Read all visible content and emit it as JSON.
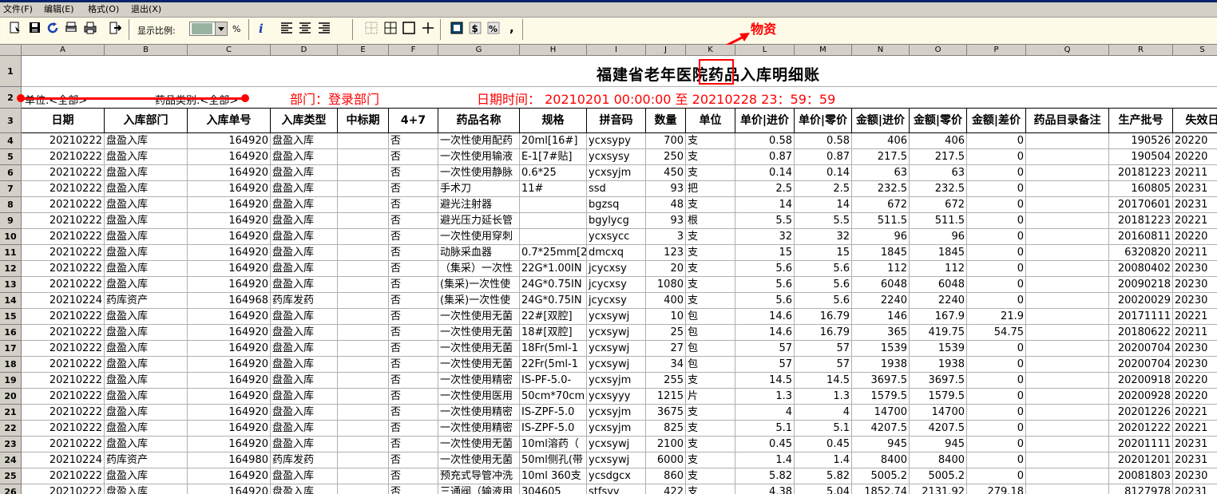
{
  "menu": [
    "文件(F)",
    "编辑(E)",
    "格式(O)",
    "退出(X)"
  ],
  "toolbar": {
    "zoom_label": "显示比例:",
    "zoom_unit": "%",
    "buttons": [
      "new-icon",
      "save-icon",
      "refresh-icon",
      "export-icon",
      "print-icon",
      "exit-icon",
      "info-icon",
      "align-left-icon",
      "align-center-icon",
      "align-right-icon",
      "grid-dotted-icon",
      "grid-all-icon",
      "grid-outer-icon",
      "grid-inner-icon",
      "number-format-icon",
      "currency-icon",
      "percent-icon",
      "comma-icon"
    ]
  },
  "annotations": {
    "wuzi": "物资",
    "bumen": "部门：登录部门",
    "riqi": "日期时间：  20210201  00:00:00  至  20210228  23：59：59",
    "color": "#ff0000"
  },
  "report": {
    "title": "福建省老年医院药品入库明细账",
    "unit_filter": "单位:<全部>",
    "drug_filter": "药品类别:<全部>"
  },
  "column_letters": [
    "A",
    "B",
    "C",
    "D",
    "E",
    "F",
    "G",
    "H",
    "I",
    "J",
    "K",
    "L",
    "M",
    "N",
    "O",
    "P",
    "Q",
    "R",
    "S"
  ],
  "headers": [
    "日期",
    "入库部门",
    "入库单号",
    "入库类型",
    "中标期",
    "4+7",
    "药品名称",
    "规格",
    "拼音码",
    "数量",
    "单位",
    "单价|进价",
    "单价|零价",
    "金额|进价",
    "金额|零价",
    "金额|差价",
    "药品目录备注",
    "生产批号",
    "失效日"
  ],
  "row_numbers": [
    "1",
    "2",
    "3",
    "4",
    "5",
    "6",
    "7",
    "8",
    "9",
    "10",
    "11",
    "12",
    "13",
    "14",
    "15",
    "16",
    "17",
    "18",
    "19",
    "20",
    "21",
    "22",
    "23",
    "24",
    "25",
    "26"
  ],
  "rows": [
    [
      "20210222",
      "盘盈入库",
      "164920",
      "盘盈入库",
      "",
      "否",
      "一次性使用配药",
      "20ml[16#]",
      "ycxsypy",
      "700",
      "支",
      "0.58",
      "0.58",
      "406",
      "406",
      "0",
      "",
      "190526",
      "20220"
    ],
    [
      "20210222",
      "盘盈入库",
      "164920",
      "盘盈入库",
      "",
      "否",
      "一次性使用输液",
      "E-1[7#贴]",
      "ycxsysy",
      "250",
      "支",
      "0.87",
      "0.87",
      "217.5",
      "217.5",
      "0",
      "",
      "190504",
      "20220"
    ],
    [
      "20210222",
      "盘盈入库",
      "164920",
      "盘盈入库",
      "",
      "否",
      "一次性使用静脉",
      "0.6*25",
      "ycxsyjm",
      "450",
      "支",
      "0.14",
      "0.14",
      "63",
      "63",
      "0",
      "",
      "20181223",
      "20211"
    ],
    [
      "20210222",
      "盘盈入库",
      "164920",
      "盘盈入库",
      "",
      "否",
      "手术刀",
      "11#",
      "ssd",
      "93",
      "把",
      "2.5",
      "2.5",
      "232.5",
      "232.5",
      "0",
      "",
      "160805",
      "20231"
    ],
    [
      "20210222",
      "盘盈入库",
      "164920",
      "盘盈入库",
      "",
      "否",
      "避光注射器",
      "",
      "bgzsq",
      "48",
      "支",
      "14",
      "14",
      "672",
      "672",
      "0",
      "",
      "20170601",
      "20231"
    ],
    [
      "20210222",
      "盘盈入库",
      "164920",
      "盘盈入库",
      "",
      "否",
      "避光压力延长管",
      "",
      "bgylycg",
      "93",
      "根",
      "5.5",
      "5.5",
      "511.5",
      "511.5",
      "0",
      "",
      "20181223",
      "20221"
    ],
    [
      "20210222",
      "盘盈入库",
      "164920",
      "盘盈入库",
      "",
      "否",
      "一次性使用穿刺",
      "",
      "ycxsycc",
      "3",
      "支",
      "32",
      "32",
      "96",
      "96",
      "0",
      "",
      "20160811",
      "20220"
    ],
    [
      "20210222",
      "盘盈入库",
      "164920",
      "盘盈入库",
      "",
      "否",
      "动脉采血器",
      "0.7*25mm[2",
      "dmcxq",
      "123",
      "支",
      "15",
      "15",
      "1845",
      "1845",
      "0",
      "",
      "6320820",
      "20211"
    ],
    [
      "20210222",
      "盘盈入库",
      "164920",
      "盘盈入库",
      "",
      "否",
      "（集采）一次性",
      "22G*1.00IN",
      "jcycxsy",
      "20",
      "支",
      "5.6",
      "5.6",
      "112",
      "112",
      "0",
      "",
      "20080402",
      "20230"
    ],
    [
      "20210222",
      "盘盈入库",
      "164920",
      "盘盈入库",
      "",
      "否",
      "(集采)一次性使",
      "24G*0.75IN",
      "jcycxsy",
      "1080",
      "支",
      "5.6",
      "5.6",
      "6048",
      "6048",
      "0",
      "",
      "20090218",
      "20230"
    ],
    [
      "20210224",
      "药库资产",
      "164968",
      "药库发药",
      "",
      "否",
      "(集采)一次性使",
      "24G*0.75IN",
      "jcycxsy",
      "400",
      "支",
      "5.6",
      "5.6",
      "2240",
      "2240",
      "0",
      "",
      "20020029",
      "20230"
    ],
    [
      "20210222",
      "盘盈入库",
      "164920",
      "盘盈入库",
      "",
      "否",
      "一次性使用无菌",
      "22#[双腔]",
      "ycxsywj",
      "10",
      "包",
      "14.6",
      "16.79",
      "146",
      "167.9",
      "21.9",
      "",
      "20171111",
      "20221"
    ],
    [
      "20210222",
      "盘盈入库",
      "164920",
      "盘盈入库",
      "",
      "否",
      "一次性使用无菌",
      "18#[双腔]",
      "ycxsywj",
      "25",
      "包",
      "14.6",
      "16.79",
      "365",
      "419.75",
      "54.75",
      "",
      "20180622",
      "20211"
    ],
    [
      "20210222",
      "盘盈入库",
      "164920",
      "盘盈入库",
      "",
      "否",
      "一次性使用无菌",
      "18Fr(5ml-1",
      "ycxsywj",
      "27",
      "包",
      "57",
      "57",
      "1539",
      "1539",
      "0",
      "",
      "20200704",
      "20230"
    ],
    [
      "20210222",
      "盘盈入库",
      "164920",
      "盘盈入库",
      "",
      "否",
      "一次性使用无菌",
      "22Fr(5ml-1",
      "ycxsywj",
      "34",
      "包",
      "57",
      "57",
      "1938",
      "1938",
      "0",
      "",
      "20200704",
      "20230"
    ],
    [
      "20210222",
      "盘盈入库",
      "164920",
      "盘盈入库",
      "",
      "否",
      "一次性使用精密",
      "IS-PF-5.0-",
      "ycxsyjm",
      "255",
      "支",
      "14.5",
      "14.5",
      "3697.5",
      "3697.5",
      "0",
      "",
      "20200918",
      "20220"
    ],
    [
      "20210222",
      "盘盈入库",
      "164920",
      "盘盈入库",
      "",
      "否",
      "一次性使用医用",
      "50cm*70cm",
      "ycxsyyy",
      "1215",
      "片",
      "1.3",
      "1.3",
      "1579.5",
      "1579.5",
      "0",
      "",
      "20200928",
      "20220"
    ],
    [
      "20210222",
      "盘盈入库",
      "164920",
      "盘盈入库",
      "",
      "否",
      "一次性使用精密",
      "IS-ZPF-5.0",
      "ycxsyjm",
      "3675",
      "支",
      "4",
      "4",
      "14700",
      "14700",
      "0",
      "",
      "20201226",
      "20221"
    ],
    [
      "20210222",
      "盘盈入库",
      "164920",
      "盘盈入库",
      "",
      "否",
      "一次性使用精密",
      "IS-ZPF-5.0",
      "ycxsyjm",
      "825",
      "支",
      "5.1",
      "5.1",
      "4207.5",
      "4207.5",
      "0",
      "",
      "20201222",
      "20221"
    ],
    [
      "20210222",
      "盘盈入库",
      "164920",
      "盘盈入库",
      "",
      "否",
      "一次性使用无菌",
      "10ml溶药（",
      "ycxsywj",
      "2100",
      "支",
      "0.45",
      "0.45",
      "945",
      "945",
      "0",
      "",
      "20201111",
      "20231"
    ],
    [
      "20210224",
      "药库资产",
      "164980",
      "药库发药",
      "",
      "否",
      "一次性使用无菌",
      "50ml侧孔(带",
      "ycxsywj",
      "6000",
      "支",
      "1.4",
      "1.4",
      "8400",
      "8400",
      "0",
      "",
      "20201201",
      "20231"
    ],
    [
      "20210222",
      "盘盈入库",
      "164920",
      "盘盈入库",
      "",
      "否",
      "预充式导管冲洗",
      "10ml   360支",
      "ycsdgcx",
      "860",
      "支",
      "5.82",
      "5.82",
      "5005.2",
      "5005.2",
      "0",
      "",
      "20081803",
      "20230"
    ],
    [
      "20210222",
      "盘盈入库",
      "164920",
      "盘盈入库",
      "",
      "否",
      "三通阀（输液用",
      "304605",
      "stfsyy",
      "422",
      "支",
      "4.38",
      "5.04",
      "1852.74",
      "2131.92",
      "279.18",
      "",
      "8127978",
      "20231"
    ]
  ]
}
